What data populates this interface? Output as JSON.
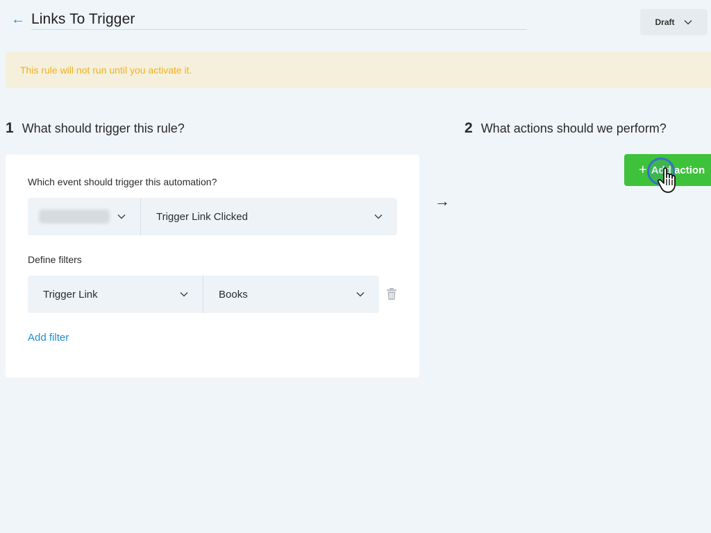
{
  "header": {
    "title": "Links To Trigger",
    "status": "Draft"
  },
  "banner": {
    "text": "This rule will not run until you activate it."
  },
  "trigger_section": {
    "number": "1",
    "heading": "What should trigger this rule?",
    "event_label": "Which event should trigger this automation?",
    "event_value": "Trigger Link Clicked",
    "filters_label": "Define filters",
    "filter": {
      "field": "Trigger Link",
      "value": "Books"
    },
    "add_filter": "Add filter"
  },
  "action_section": {
    "number": "2",
    "heading": "What actions should we perform?",
    "add_action": "Add action"
  },
  "flow_arrow": "→",
  "colors": {
    "accent_blue": "#1a90d8",
    "banner_bg": "#f5f0dc",
    "banner_text": "#f2b01e",
    "add_action_green": "#3ec23b"
  }
}
